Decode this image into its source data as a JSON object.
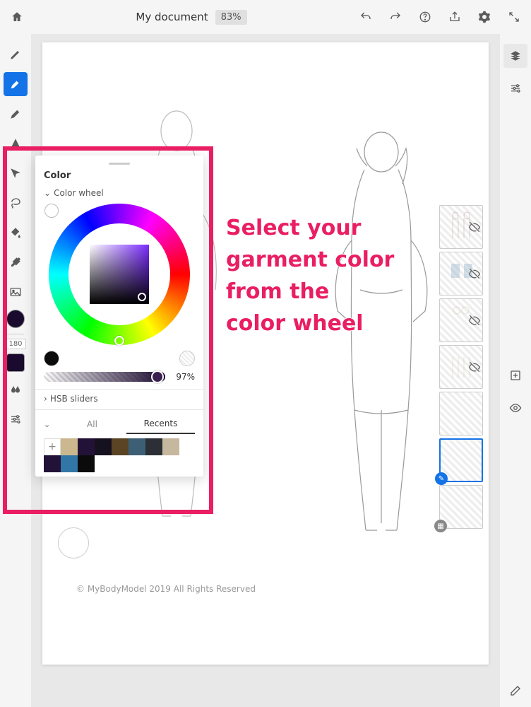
{
  "top": {
    "title": "My document",
    "zoom": "83%"
  },
  "left_tools": {
    "rotation_value": "180"
  },
  "color_panel": {
    "title": "Color",
    "wheel_label": "Color wheel",
    "opacity_label": "97%",
    "hsb_label": "HSB sliders",
    "swatch_tabs": {
      "all": "All",
      "recents": "Recents"
    },
    "recent_colors": [
      "#cbb88f",
      "#221237",
      "#16111e",
      "#5b4424",
      "#3d5f76",
      "#2c3036",
      "#c6b89e",
      "#221237",
      "#3276a8",
      "#0b0b0b"
    ],
    "current_hex": "#1a0a2e"
  },
  "annotation": {
    "l1": "Select your",
    "l2": "garment color",
    "l3": "from the",
    "l4": "color wheel"
  },
  "copyright": "© MyBodyModel 2019 All Rights Reserved"
}
